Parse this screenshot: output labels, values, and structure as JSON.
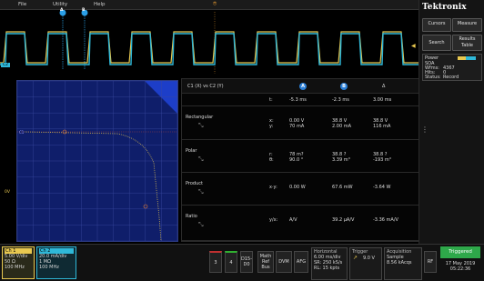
{
  "menu": {
    "file": "File",
    "utility": "Utility",
    "help": "Help"
  },
  "brand": {
    "logo": "Tektronix"
  },
  "sidebar": {
    "cursors": "Cursors",
    "measure": "Measure",
    "search": "Search",
    "results_table": "Results Table",
    "power_title": "Power",
    "power_line1": "SOA",
    "power_line2_k": "Wfms:",
    "power_line2_v": "4367",
    "power_line3_k": "Hits:",
    "power_line3_v": "0",
    "power_line4_k": "Status:",
    "power_line4_v": "Record"
  },
  "waveform": {
    "label_a": "A",
    "label_b": "B",
    "channel_tag": "C2"
  },
  "xy_plot": {
    "ch_label": "C1",
    "y_mark_left": "0V"
  },
  "measurements": {
    "header": {
      "title": "C1 (X) vs C2 (Y)",
      "col_a": "A",
      "col_b": "B",
      "col_delta": "Δ"
    },
    "time_row": {
      "label": "t:",
      "a": "-5.3 ms",
      "b": "-2.3 ms",
      "d": "3.00 ms"
    },
    "rows": [
      {
        "name": "Rectangular",
        "k1": "x:",
        "k2": "y:",
        "a1": "0.00 V",
        "a2": "70 mA",
        "b1": "38.8 V",
        "b2": "2.00 mA",
        "d1": "38.8 V",
        "d2": "116 mA"
      },
      {
        "name": "Polar",
        "k1": "r:",
        "k2": "θ:",
        "a1": "78 m?",
        "a2": "90.0 °",
        "b1": "38.8 ?",
        "b2": "3.39 m°",
        "d1": "38.8 ?",
        "d2": "-193 m°"
      },
      {
        "name": "Product",
        "k1": "x·y:",
        "k2": "",
        "a1": "0.00 W",
        "a2": "",
        "b1": "67.6 mW",
        "b2": "",
        "d1": "-3.64 W",
        "d2": ""
      },
      {
        "name": "Ratio",
        "k1": "y/x:",
        "k2": "",
        "a1": "A/V",
        "a2": "",
        "b1": "39.2 μA/V",
        "b2": "",
        "d1": "-3.36 mA/V",
        "d2": ""
      }
    ]
  },
  "bottom": {
    "ch1": {
      "title": "Ch 1",
      "l1": "5.00 V/div",
      "l2": "50 Ω",
      "l3": "100 MHz"
    },
    "ch2": {
      "title": "Ch 2",
      "l1": "20.0 mA/div",
      "l2": "1 MΩ",
      "l3": "100 MHz"
    },
    "btn3": "3",
    "btn4": "4",
    "btn_dvm_ab": "D15-\nD0",
    "btn_math": "Math\nRef\nBus",
    "btn_dvm": "DVM",
    "btn_afg": "AFG",
    "horizontal": {
      "title": "Horizontal",
      "l1": "6.00 ms/div",
      "l2": "SR: 250 kS/s",
      "l3": "RL: 15 kpts"
    },
    "trigger": {
      "title": "Trigger",
      "l1": "9.0 V"
    },
    "acquisition": {
      "title": "Acquisition",
      "l1": "Sample",
      "l2": "8.56 kAcqs"
    },
    "rf": "RF",
    "triggered": "Triggered",
    "date": "17 May 2019",
    "time": "05:22:36"
  }
}
